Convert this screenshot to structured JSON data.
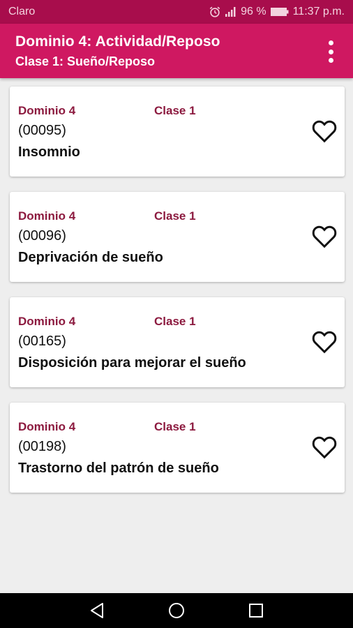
{
  "status_bar": {
    "carrier": "Claro",
    "battery": "96 %",
    "time": "11:37 p.m.",
    "icons": [
      "alarm-icon",
      "signal-icon",
      "battery-icon"
    ]
  },
  "app_bar": {
    "title": "Dominio 4: Actividad/Reposo",
    "subtitle": "Clase 1: Sueño/Reposo",
    "menu_icon": "more-vert-icon"
  },
  "cards": [
    {
      "dominio": "Dominio 4",
      "clase": "Clase 1",
      "code": "(00095)",
      "name": "Insomnio"
    },
    {
      "dominio": "Dominio 4",
      "clase": "Clase 1",
      "code": "(00096)",
      "name": "Deprivación de sueño"
    },
    {
      "dominio": "Dominio 4",
      "clase": "Clase 1",
      "code": "(00165)",
      "name": "Disposición para mejorar el sueño"
    },
    {
      "dominio": "Dominio 4",
      "clase": "Clase 1",
      "code": "(00198)",
      "name": "Trastorno del patrón de sueño"
    }
  ],
  "nav_bar": {
    "icons": [
      "back-icon",
      "home-icon",
      "recents-icon"
    ]
  },
  "colors": {
    "status_bar": "#a80d4c",
    "app_bar": "#cf1861",
    "label": "#8c1a3f",
    "background": "#eeeeee"
  }
}
